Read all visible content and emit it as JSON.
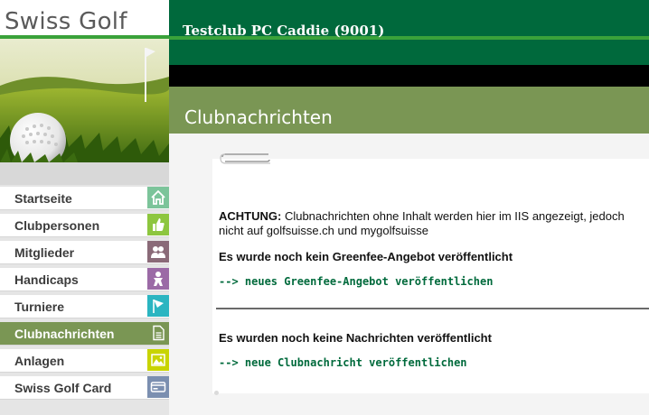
{
  "brand": {
    "logo_text": "Swiss Golf"
  },
  "header": {
    "club_title": "Testclub PC Caddie (9001)"
  },
  "page": {
    "title": "Clubnachrichten"
  },
  "nav": {
    "items": [
      {
        "label": "Startseite",
        "icon": "home-icon",
        "icon_color": "#7cc49a"
      },
      {
        "label": "Clubpersonen",
        "icon": "thumbs-up-icon",
        "icon_color": "#8dc63f"
      },
      {
        "label": "Mitglieder",
        "icon": "members-icon",
        "icon_color": "#8a6a78"
      },
      {
        "label": "Handicaps",
        "icon": "handicap-person-icon",
        "icon_color": "#9b6aa6"
      },
      {
        "label": "Turniere",
        "icon": "flag-icon",
        "icon_color": "#2bb5c1"
      },
      {
        "label": "Clubnachrichten",
        "icon": "document-icon",
        "icon_color": "#7a9654",
        "active": true
      },
      {
        "label": "Anlagen",
        "icon": "image-icon",
        "icon_color": "#c8d400"
      },
      {
        "label": "Swiss Golf Card",
        "icon": "card-icon",
        "icon_color": "#7b8fb0"
      }
    ]
  },
  "content": {
    "warning_label": "ACHTUNG:",
    "warning_text": " Clubnachrichten ohne Inhalt werden hier im IIS angezeigt, jedoch nicht auf golfsuisse.ch und mygolfsuisse",
    "greenfee_message": "Es wurde noch kein Greenfee-Angebot veröffentlicht",
    "greenfee_link": "--> neues Greenfee-Angebot veröffentlichen",
    "news_message": "Es wurden noch keine Nachrichten veröffentlicht",
    "news_link": "--> neue Clubnachricht veröffentlichen"
  },
  "colors": {
    "header_green": "#00693c",
    "accent_green": "#3aa23a",
    "olive": "#7a9654",
    "link_green": "#006a3c"
  }
}
